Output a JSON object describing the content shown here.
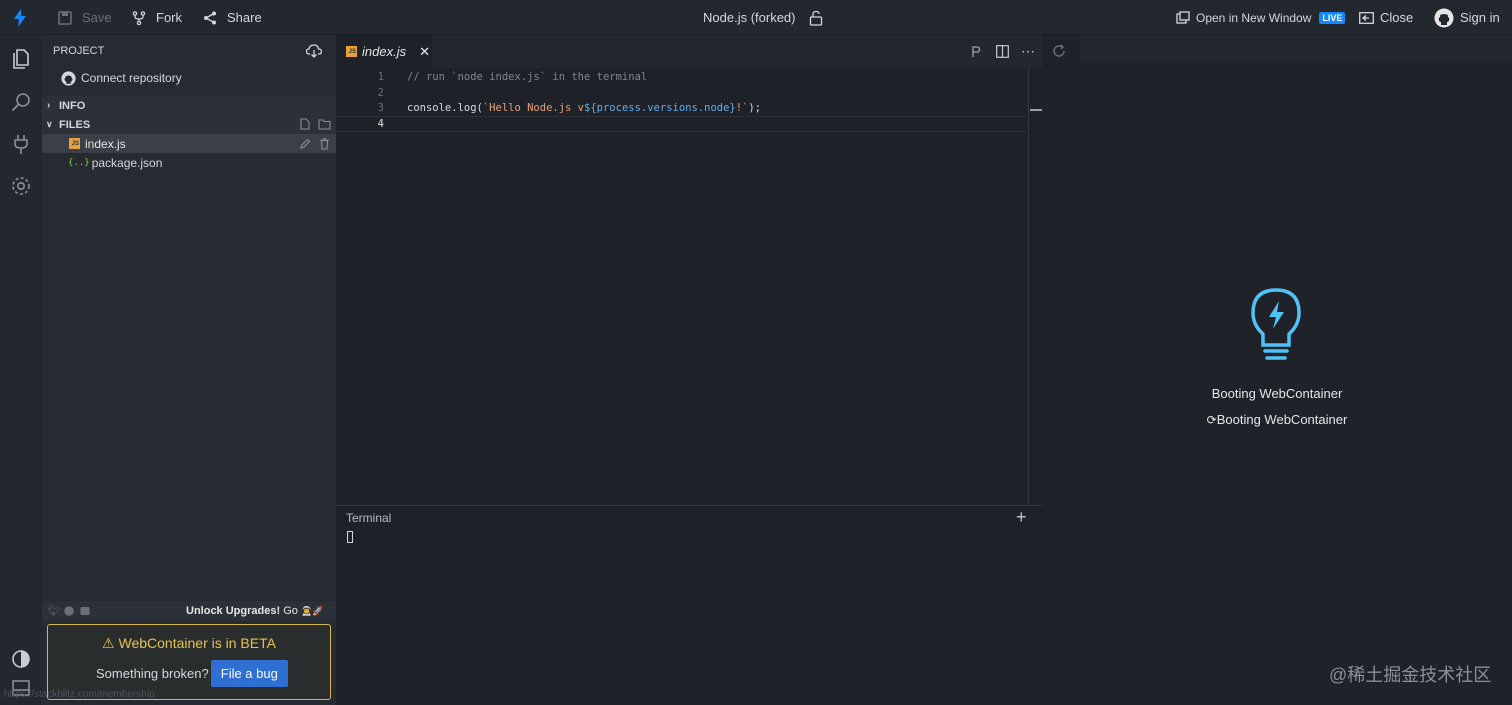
{
  "topbar": {
    "save_label": "Save",
    "fork_label": "Fork",
    "share_label": "Share",
    "project_title": "Node.js (forked)",
    "open_new_window_label": "Open in New Window",
    "live_badge": "LIVE",
    "close_label": "Close",
    "sign_in_label": "Sign in"
  },
  "sidebar": {
    "project_header": "PROJECT",
    "connect_repo_label": "Connect repository",
    "info_section": "INFO",
    "files_section": "FILES",
    "files": [
      {
        "name": "index.js",
        "icon": "js-file-icon",
        "selected": true
      },
      {
        "name": "package.json",
        "icon": "json-file-icon",
        "selected": false
      }
    ],
    "unlock_text": "Unlock Upgrades!",
    "unlock_go": "Go",
    "unlock_emojis": "👨‍🚀🚀",
    "beta_title": "WebContainer is in BETA",
    "beta_question": "Something broken?",
    "file_bug_label": "File a bug",
    "status_url": "https://stackblitz.com/membership"
  },
  "editor": {
    "active_tab": "index.js",
    "tab_icon_text": "JS",
    "line_numbers": [
      "1",
      "2",
      "3",
      "4"
    ],
    "code": {
      "line1_comment": "// run `node index.js` in the terminal",
      "line3_fn": "console.log(",
      "line3_str1": "`Hello Node.js v",
      "line3_tmpl": "${process.versions.node}",
      "line3_str2": "!`",
      "line3_end": ");"
    }
  },
  "terminal": {
    "label": "Terminal"
  },
  "preview": {
    "booting_title": "Booting WebContainer",
    "booting_status": "Booting WebContainer"
  },
  "watermark": "@稀土掘金技术社区",
  "colors": {
    "accent": "#1389fd",
    "bulb": "#4fc3f7",
    "warning": "#e8c34a"
  }
}
